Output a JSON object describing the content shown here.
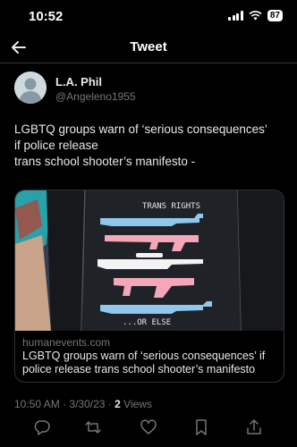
{
  "status_bar": {
    "time": "10:52",
    "battery": "87"
  },
  "header": {
    "title": "Tweet"
  },
  "tweet": {
    "display_name": "L.A. Phil",
    "handle": "@Angeleno1955",
    "text_lines": [
      "LGBTQ groups warn of ‘serious consequences’",
      "if police release",
      "trans school shooter’s manifesto -"
    ],
    "card": {
      "image_texts": {
        "top": "TRANS RIGHTS",
        "bottom": "...OR ELSE"
      },
      "domain": "humanevents.com",
      "title": "LGBTQ groups warn of ‘serious consequences’ if police release trans school shooter’s manifesto"
    },
    "time": "10:50 AM",
    "date": "3/30/23",
    "views_count": "2",
    "views_label": "Views"
  },
  "actions": [
    "reply-icon",
    "retweet-icon",
    "like-icon",
    "bookmark-icon",
    "share-icon"
  ],
  "colors": {
    "background": "#000000",
    "text": "#e7e9ea",
    "secondary": "#71767b",
    "divider": "#2f3336",
    "trans_blue": "#8fc8ec",
    "trans_pink": "#f3a7b8"
  }
}
